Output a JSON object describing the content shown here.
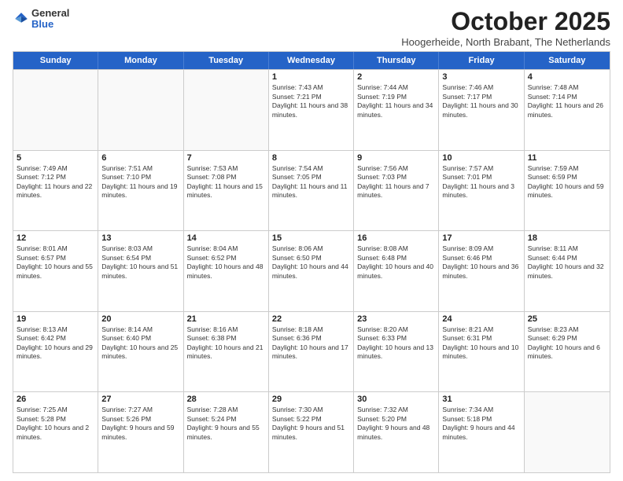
{
  "logo": {
    "general": "General",
    "blue": "Blue"
  },
  "header": {
    "month": "October 2025",
    "location": "Hoogerheide, North Brabant, The Netherlands"
  },
  "weekdays": [
    "Sunday",
    "Monday",
    "Tuesday",
    "Wednesday",
    "Thursday",
    "Friday",
    "Saturday"
  ],
  "rows": [
    [
      {
        "day": "",
        "empty": true
      },
      {
        "day": "",
        "empty": true
      },
      {
        "day": "",
        "empty": true
      },
      {
        "day": "1",
        "sunrise": "Sunrise: 7:43 AM",
        "sunset": "Sunset: 7:21 PM",
        "daylight": "Daylight: 11 hours and 38 minutes."
      },
      {
        "day": "2",
        "sunrise": "Sunrise: 7:44 AM",
        "sunset": "Sunset: 7:19 PM",
        "daylight": "Daylight: 11 hours and 34 minutes."
      },
      {
        "day": "3",
        "sunrise": "Sunrise: 7:46 AM",
        "sunset": "Sunset: 7:17 PM",
        "daylight": "Daylight: 11 hours and 30 minutes."
      },
      {
        "day": "4",
        "sunrise": "Sunrise: 7:48 AM",
        "sunset": "Sunset: 7:14 PM",
        "daylight": "Daylight: 11 hours and 26 minutes."
      }
    ],
    [
      {
        "day": "5",
        "sunrise": "Sunrise: 7:49 AM",
        "sunset": "Sunset: 7:12 PM",
        "daylight": "Daylight: 11 hours and 22 minutes."
      },
      {
        "day": "6",
        "sunrise": "Sunrise: 7:51 AM",
        "sunset": "Sunset: 7:10 PM",
        "daylight": "Daylight: 11 hours and 19 minutes."
      },
      {
        "day": "7",
        "sunrise": "Sunrise: 7:53 AM",
        "sunset": "Sunset: 7:08 PM",
        "daylight": "Daylight: 11 hours and 15 minutes."
      },
      {
        "day": "8",
        "sunrise": "Sunrise: 7:54 AM",
        "sunset": "Sunset: 7:05 PM",
        "daylight": "Daylight: 11 hours and 11 minutes."
      },
      {
        "day": "9",
        "sunrise": "Sunrise: 7:56 AM",
        "sunset": "Sunset: 7:03 PM",
        "daylight": "Daylight: 11 hours and 7 minutes."
      },
      {
        "day": "10",
        "sunrise": "Sunrise: 7:57 AM",
        "sunset": "Sunset: 7:01 PM",
        "daylight": "Daylight: 11 hours and 3 minutes."
      },
      {
        "day": "11",
        "sunrise": "Sunrise: 7:59 AM",
        "sunset": "Sunset: 6:59 PM",
        "daylight": "Daylight: 10 hours and 59 minutes."
      }
    ],
    [
      {
        "day": "12",
        "sunrise": "Sunrise: 8:01 AM",
        "sunset": "Sunset: 6:57 PM",
        "daylight": "Daylight: 10 hours and 55 minutes."
      },
      {
        "day": "13",
        "sunrise": "Sunrise: 8:03 AM",
        "sunset": "Sunset: 6:54 PM",
        "daylight": "Daylight: 10 hours and 51 minutes."
      },
      {
        "day": "14",
        "sunrise": "Sunrise: 8:04 AM",
        "sunset": "Sunset: 6:52 PM",
        "daylight": "Daylight: 10 hours and 48 minutes."
      },
      {
        "day": "15",
        "sunrise": "Sunrise: 8:06 AM",
        "sunset": "Sunset: 6:50 PM",
        "daylight": "Daylight: 10 hours and 44 minutes."
      },
      {
        "day": "16",
        "sunrise": "Sunrise: 8:08 AM",
        "sunset": "Sunset: 6:48 PM",
        "daylight": "Daylight: 10 hours and 40 minutes."
      },
      {
        "day": "17",
        "sunrise": "Sunrise: 8:09 AM",
        "sunset": "Sunset: 6:46 PM",
        "daylight": "Daylight: 10 hours and 36 minutes."
      },
      {
        "day": "18",
        "sunrise": "Sunrise: 8:11 AM",
        "sunset": "Sunset: 6:44 PM",
        "daylight": "Daylight: 10 hours and 32 minutes."
      }
    ],
    [
      {
        "day": "19",
        "sunrise": "Sunrise: 8:13 AM",
        "sunset": "Sunset: 6:42 PM",
        "daylight": "Daylight: 10 hours and 29 minutes."
      },
      {
        "day": "20",
        "sunrise": "Sunrise: 8:14 AM",
        "sunset": "Sunset: 6:40 PM",
        "daylight": "Daylight: 10 hours and 25 minutes."
      },
      {
        "day": "21",
        "sunrise": "Sunrise: 8:16 AM",
        "sunset": "Sunset: 6:38 PM",
        "daylight": "Daylight: 10 hours and 21 minutes."
      },
      {
        "day": "22",
        "sunrise": "Sunrise: 8:18 AM",
        "sunset": "Sunset: 6:36 PM",
        "daylight": "Daylight: 10 hours and 17 minutes."
      },
      {
        "day": "23",
        "sunrise": "Sunrise: 8:20 AM",
        "sunset": "Sunset: 6:33 PM",
        "daylight": "Daylight: 10 hours and 13 minutes."
      },
      {
        "day": "24",
        "sunrise": "Sunrise: 8:21 AM",
        "sunset": "Sunset: 6:31 PM",
        "daylight": "Daylight: 10 hours and 10 minutes."
      },
      {
        "day": "25",
        "sunrise": "Sunrise: 8:23 AM",
        "sunset": "Sunset: 6:29 PM",
        "daylight": "Daylight: 10 hours and 6 minutes."
      }
    ],
    [
      {
        "day": "26",
        "sunrise": "Sunrise: 7:25 AM",
        "sunset": "Sunset: 5:28 PM",
        "daylight": "Daylight: 10 hours and 2 minutes."
      },
      {
        "day": "27",
        "sunrise": "Sunrise: 7:27 AM",
        "sunset": "Sunset: 5:26 PM",
        "daylight": "Daylight: 9 hours and 59 minutes."
      },
      {
        "day": "28",
        "sunrise": "Sunrise: 7:28 AM",
        "sunset": "Sunset: 5:24 PM",
        "daylight": "Daylight: 9 hours and 55 minutes."
      },
      {
        "day": "29",
        "sunrise": "Sunrise: 7:30 AM",
        "sunset": "Sunset: 5:22 PM",
        "daylight": "Daylight: 9 hours and 51 minutes."
      },
      {
        "day": "30",
        "sunrise": "Sunrise: 7:32 AM",
        "sunset": "Sunset: 5:20 PM",
        "daylight": "Daylight: 9 hours and 48 minutes."
      },
      {
        "day": "31",
        "sunrise": "Sunrise: 7:34 AM",
        "sunset": "Sunset: 5:18 PM",
        "daylight": "Daylight: 9 hours and 44 minutes."
      },
      {
        "day": "",
        "empty": true
      }
    ]
  ]
}
